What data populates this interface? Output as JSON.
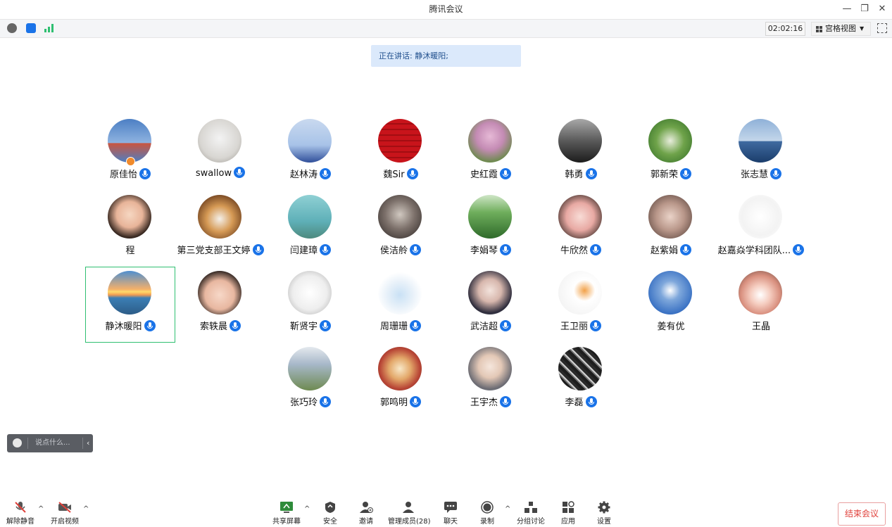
{
  "window": {
    "title": "腾讯会议"
  },
  "topbar": {
    "timer": "02:02:16",
    "view_label": "宫格视图"
  },
  "speaking": {
    "text": "正在讲话: 静沐暖阳;"
  },
  "participants": [
    {
      "name": "原佳怡",
      "mic": true,
      "host": true,
      "avatar_bg": "linear-gradient(180deg,#4c7fc4 0%,#8fb3e0 55%,#c9553f 56%,#4c7fc4 100%)"
    },
    {
      "name": "swallow",
      "mic": true,
      "avatar_bg": "radial-gradient(circle at 50% 45%,#f3f3f3 0%,#d8d6d2 60%,#9a968f 100%)"
    },
    {
      "name": "赵林涛",
      "mic": true,
      "avatar_bg": "linear-gradient(180deg,#c9d9ef 0%,#a8c3e8 60%,#304f9a 100%)"
    },
    {
      "name": "魏Sir",
      "mic": true,
      "avatar_bg": "repeating-linear-gradient(0deg,#c8141b 0 6px,#a30d12 6px 8px)"
    },
    {
      "name": "史红霞",
      "mic": true,
      "avatar_bg": "radial-gradient(circle at 50% 40%,#e6b9d6 0%,#c48bb4 40%,#6d8a4e 75%,#f0ede8 100%)"
    },
    {
      "name": "韩勇",
      "mic": true,
      "avatar_bg": "linear-gradient(180deg,#a8a8a8 0%,#5a5a5a 50%,#1c1c1c 100%)"
    },
    {
      "name": "郭新荣",
      "mic": true,
      "avatar_bg": "radial-gradient(circle at 50% 50%,#e8eddc 0%,#6fa34a 45%,#2f6b25 100%)"
    },
    {
      "name": "张志慧",
      "mic": true,
      "avatar_bg": "linear-gradient(180deg,#8fb1d8 0%,#c3d6ea 50%,#3f6aa0 52%,#1b3d6b 100%)"
    },
    {
      "name": "程",
      "mic": false,
      "avatar_bg": "radial-gradient(circle at 50% 45%,#f6d7c2 0%,#e8b499 40%,#3a2a22 70%,#1a1614 100%)"
    },
    {
      "name": "第三党支部王文婷",
      "mic": true,
      "avatar_bg": "radial-gradient(circle at 50% 55%,#f4f0ea 0%,#d69a55 40%,#7a4a24 75%,#2a1f16 100%)"
    },
    {
      "name": "闫建璋",
      "mic": true,
      "avatar_bg": "linear-gradient(180deg,#8fd0d4 0%,#5fb0b8 60%,#4d8a7e 100%)"
    },
    {
      "name": "侯洁舲",
      "mic": true,
      "avatar_bg": "radial-gradient(circle at 50% 45%,#d0c8c0 0%,#7d716b 45%,#2a2422 100%)"
    },
    {
      "name": "李娟琴",
      "mic": true,
      "avatar_bg": "linear-gradient(180deg,#cfe6c7 0%,#6fae5c 40%,#2e6a2a 100%)"
    },
    {
      "name": "牛欣然",
      "mic": true,
      "avatar_bg": "radial-gradient(circle at 50% 50%,#f8dcd6 0%,#e8a9a3 45%,#3b2b26 85%)"
    },
    {
      "name": "赵紫娟",
      "mic": true,
      "avatar_bg": "radial-gradient(circle at 50% 50%,#ead3c8 0%,#b9978a 45%,#4a3630 100%)"
    },
    {
      "name": "赵嘉焱学科团队...",
      "mic": true,
      "avatar_bg": "radial-gradient(circle at 50% 50%,#ffffff 0%,#f3f3f3 60%,#ffffff 100%)"
    },
    {
      "name": "静沐暖阳",
      "mic": true,
      "active": true,
      "avatar_bg": "linear-gradient(180deg,#4f8fd0 0%,#f4b06a 42%,#ffda6a 48%,#f19b52 55%,#3c7fb5 62%,#2c5c87 100%)"
    },
    {
      "name": "索轶晨",
      "mic": true,
      "avatar_bg": "radial-gradient(circle at 50% 55%,#f7d8c8 0%,#e8b7a0 45%,#2b211d 75%,#0e0c0b 100%)"
    },
    {
      "name": "靳贤宇",
      "mic": true,
      "avatar_bg": "radial-gradient(circle at 50% 50%,#ffffff 0%,#eeeeee 55%,#a9a9a9 100%)"
    },
    {
      "name": "周珊珊",
      "mic": true,
      "avatar_bg": "radial-gradient(circle at 50% 55%,#c9e1f5 0%,#e8f1f9 40%,#ffffff 70%)"
    },
    {
      "name": "武洁超",
      "mic": true,
      "avatar_bg": "radial-gradient(circle at 50% 45%,#f3e3dc 0%,#d7b7ad 35%,#2b2a3a 70%,#f3f3f5 100%)"
    },
    {
      "name": "王卫丽",
      "mic": true,
      "avatar_bg": "radial-gradient(circle at 60% 45%,#f2a24a 0%,#ffffff 30%,#eeeeee 100%)"
    },
    {
      "name": "姜有优",
      "mic": false,
      "avatar_bg": "radial-gradient(circle at 50% 45%,#ffffff 0%,#7ea7db 30%,#3c73c4 70%,#2a5aa8 100%)"
    },
    {
      "name": "王晶",
      "mic": false,
      "avatar_bg": "radial-gradient(circle at 50% 55%,#ffffff 0%,#f5cdc0 30%,#d9907f 60%,#5b4038 100%)"
    },
    {
      "name": "张巧玲",
      "mic": true,
      "avatar_bg": "linear-gradient(180deg,#e4e9ee 0%,#a7b8c9 40%,#6e8a51 100%)"
    },
    {
      "name": "郭鸣明",
      "mic": true,
      "avatar_bg": "radial-gradient(circle at 50% 50%,#f8e8c8 0%,#e3a86a 35%,#b84636 65%,#6b2a22 100%)"
    },
    {
      "name": "王宇杰",
      "mic": true,
      "avatar_bg": "radial-gradient(circle at 50% 45%,#f5e6dc 0%,#e3c8b6 35%,#6a6a72 70%,#d8dde3 100%)"
    },
    {
      "name": "李磊",
      "mic": true,
      "avatar_bg": "repeating-linear-gradient(45deg,#1d1d1d 0 4px,#6f6f6f 4px 6px,#d0d0d0 6px 8px,#2a2a2a 8px 12px)"
    }
  ],
  "chat": {
    "placeholder": "说点什么..."
  },
  "bottombar": {
    "unmute": "解除静音",
    "start_video": "开启视频",
    "share_screen": "共享屏幕",
    "security": "安全",
    "invite": "邀请",
    "manage_members": "管理成员(28)",
    "chat": "聊天",
    "record": "录制",
    "breakout": "分组讨论",
    "apps": "应用",
    "settings": "设置",
    "end_meeting": "结束会议"
  },
  "colors": {
    "accent": "#1a73e8",
    "active_border": "#2fbf71",
    "end_red": "#e0413b",
    "speaking_bg": "#dbe9fb"
  }
}
